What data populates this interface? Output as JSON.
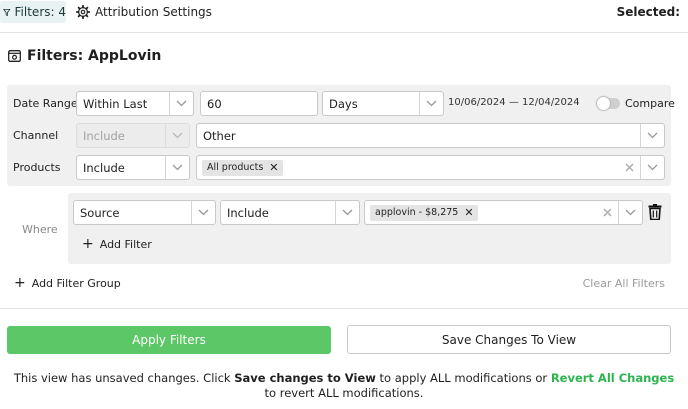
{
  "topbar": {
    "filters_label": "Filters: 4",
    "attribution_label": "Attribution Settings",
    "selected_label": "Selected:"
  },
  "panel": {
    "title": "Filters: AppLovin"
  },
  "date_range": {
    "label": "Date Range",
    "operator": "Within Last",
    "amount": "60",
    "unit": "Days",
    "range_text": "10/06/2024 — 12/04/2024",
    "compare_label": "Compare",
    "compare_on": false
  },
  "channel": {
    "label": "Channel",
    "operator": "Include",
    "value": "Other"
  },
  "products": {
    "label": "Products",
    "operator": "Include",
    "tag": "All products"
  },
  "where": {
    "label": "Where",
    "field": "Source",
    "operator": "Include",
    "tag": "applovin - $8,275",
    "add_filter_label": "Add Filter"
  },
  "footer_actions": {
    "add_group_label": "Add Filter Group",
    "clear_all_label": "Clear All Filters"
  },
  "buttons": {
    "apply_label": "Apply Filters",
    "save_label": "Save Changes To View"
  },
  "notice": {
    "part1": "This view has unsaved changes. Click ",
    "save_link": "Save changes to View",
    "part2": " to apply ALL modifications or ",
    "revert_link": "Revert All Changes",
    "part3": " to revert ALL modifications."
  },
  "colors": {
    "accent_green": "#5cc766",
    "link_green": "#2bb44f",
    "filter_chip_bg": "#e8f2f2",
    "panel_grey": "#f0f0f0"
  }
}
